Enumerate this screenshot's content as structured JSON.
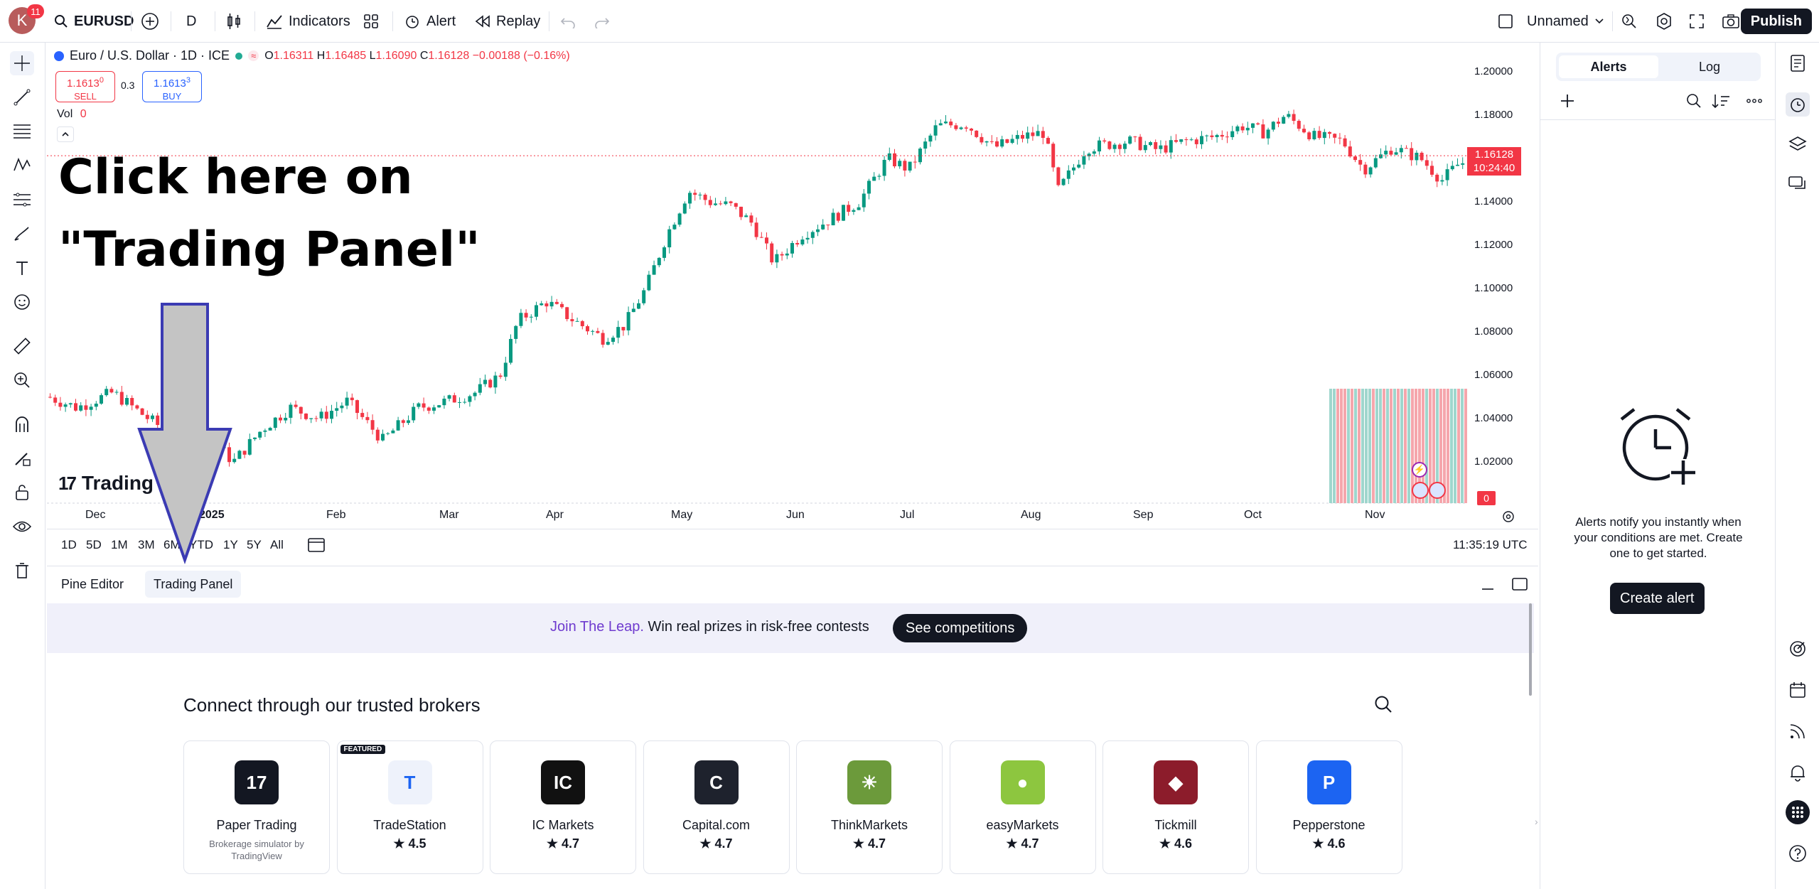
{
  "topbar": {
    "avatar_letter": "K",
    "avatar_badge": "11",
    "symbol": "EURUSD",
    "interval": "D",
    "indicators": "Indicators",
    "alert": "Alert",
    "replay": "Replay",
    "layout_name": "Unnamed",
    "publish": "Publish"
  },
  "legend": {
    "title": "Euro / U.S. Dollar · 1D · ICE",
    "open_label": "O",
    "open": "1.16311",
    "high_label": "H",
    "high": "1.16485",
    "low_label": "L",
    "low": "1.16090",
    "close_label": "C",
    "close": "1.16128",
    "change": "−0.00188 (−0.16%)",
    "sell_price": "1.1613",
    "sell_price_sup": "0",
    "sell_label": "SELL",
    "spread": "0.3",
    "buy_price": "1.1613",
    "buy_price_sup": "3",
    "buy_label": "BUY",
    "vol_label": "Vol",
    "vol_value": "0"
  },
  "price_axis": {
    "ticks": [
      "1.20000",
      "1.18000",
      "1.16000",
      "1.14000",
      "1.12000",
      "1.10000",
      "1.08000",
      "1.06000",
      "1.04000",
      "1.02000"
    ],
    "current_price": "1.16128",
    "countdown": "10:24:40",
    "zero_badge": "0"
  },
  "time_axis": {
    "months": [
      "Dec",
      "2025",
      "Feb",
      "Mar",
      "Apr",
      "May",
      "Jun",
      "Jul",
      "Aug",
      "Sep",
      "Oct",
      "Nov"
    ]
  },
  "watermark": "Trading",
  "range_bar": {
    "ranges": [
      "1D",
      "5D",
      "1M",
      "3M",
      "6M",
      "YTD",
      "1Y",
      "5Y",
      "All"
    ],
    "clock": "11:35:19 UTC"
  },
  "overlay": {
    "line1": "Click here on",
    "line2": "\"Trading Panel\""
  },
  "bottom_panel": {
    "tabs": [
      "Pine Editor",
      "Trading Panel"
    ],
    "banner_link": "Join The Leap.",
    "banner_text": "Win real prizes in risk-free contests",
    "banner_button": "See competitions",
    "brokers_title": "Connect through our trusted brokers",
    "featured_badge": "FEATURED",
    "brokers": [
      {
        "name": "Paper Trading",
        "sub": "Brokerage simulator by TradingView",
        "rating": "",
        "logo_text": "17",
        "logo_bg": "#131722"
      },
      {
        "name": "TradeStation",
        "sub": "",
        "rating": "4.5",
        "logo_text": "T",
        "logo_bg": "#eef2fb"
      },
      {
        "name": "IC Markets",
        "sub": "",
        "rating": "4.7",
        "logo_text": "IC",
        "logo_bg": "#111111"
      },
      {
        "name": "Capital.com",
        "sub": "",
        "rating": "4.7",
        "logo_text": "C",
        "logo_bg": "#1e222d"
      },
      {
        "name": "ThinkMarkets",
        "sub": "",
        "rating": "4.7",
        "logo_text": "☀",
        "logo_bg": "#6c9a3b"
      },
      {
        "name": "easyMarkets",
        "sub": "",
        "rating": "4.7",
        "logo_text": "●",
        "logo_bg": "#8dc63f"
      },
      {
        "name": "Tickmill",
        "sub": "",
        "rating": "4.6",
        "logo_text": "◆",
        "logo_bg": "#8c1c2b"
      },
      {
        "name": "Pepperstone",
        "sub": "",
        "rating": "4.6",
        "logo_text": "P",
        "logo_bg": "#1c64f2"
      }
    ]
  },
  "alerts_panel": {
    "tab_alerts": "Alerts",
    "tab_log": "Log",
    "empty_text": "Alerts notify you instantly when your conditions are met. Create one to get started.",
    "create_button": "Create alert"
  },
  "colors": {
    "up": "#089981",
    "down": "#f23645",
    "accent": "#2962ff",
    "arrow_fill": "#c4c4c4",
    "arrow_stroke": "#3b3bb3"
  }
}
